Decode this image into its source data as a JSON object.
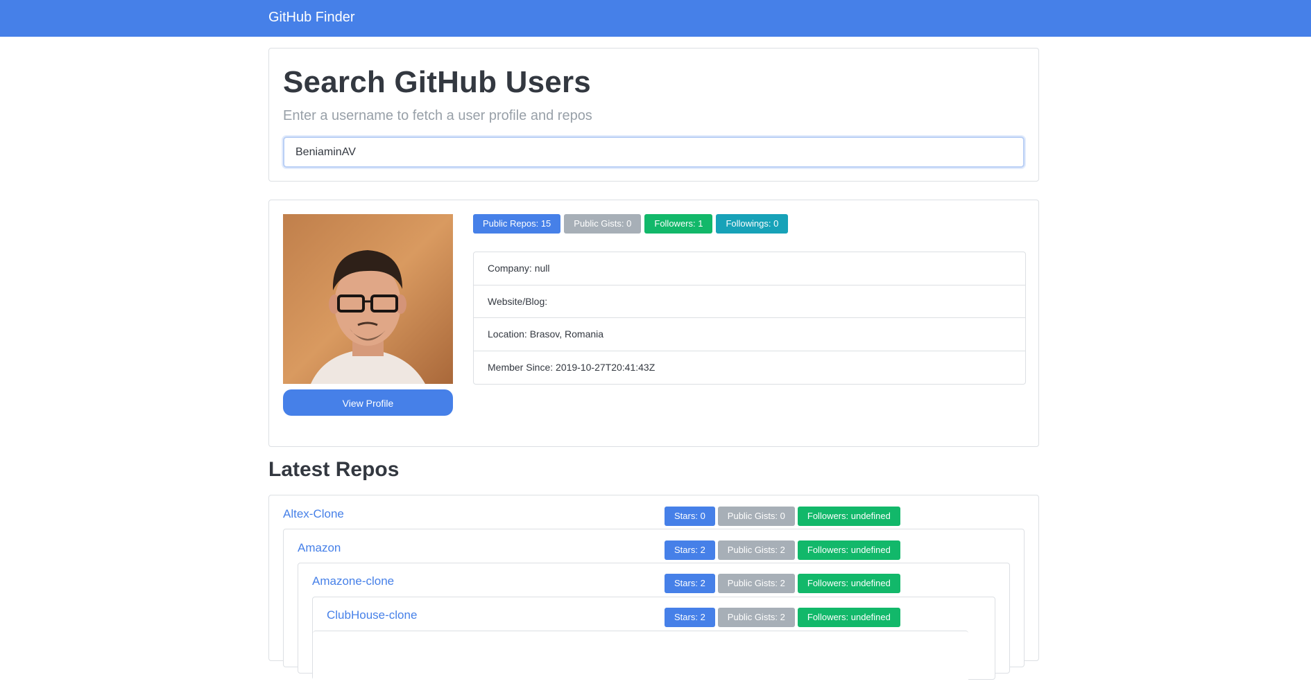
{
  "navbar": {
    "brand": "GitHub Finder"
  },
  "search": {
    "title": "Search GitHub Users",
    "subtitle": "Enter a username to fetch a user profile and repos",
    "value": "BeniaminAV",
    "placeholder": ""
  },
  "profile": {
    "view_profile_label": "View Profile",
    "badges": [
      {
        "label": "Public Repos: 15",
        "color": "#4680e8"
      },
      {
        "label": "Public Gists: 0",
        "color": "#a7afb7"
      },
      {
        "label": "Followers: 1",
        "color": "#12b86a"
      },
      {
        "label": "Followings: 0",
        "color": "#17a2b8"
      }
    ],
    "info": [
      "Company: null",
      "Website/Blog:",
      "Location: Brasov, Romania",
      "Member Since: 2019-10-27T20:41:43Z"
    ]
  },
  "repos": {
    "title": "Latest Repos",
    "items": [
      {
        "name": "Altex-Clone",
        "stars": "Stars: 0",
        "gists": "Public Gists: 0",
        "followers": "Followers: undefined"
      },
      {
        "name": "Amazon",
        "stars": "Stars: 2",
        "gists": "Public Gists: 2",
        "followers": "Followers: undefined"
      },
      {
        "name": "Amazone-clone",
        "stars": "Stars: 2",
        "gists": "Public Gists: 2",
        "followers": "Followers: undefined"
      },
      {
        "name": "ClubHouse-clone",
        "stars": "Stars: 2",
        "gists": "Public Gists: 2",
        "followers": "Followers: undefined"
      }
    ]
  },
  "colors": {
    "accent": "#4680e8",
    "gray_badge": "#a7afb7",
    "green_badge": "#12b86a",
    "teal_badge": "#17a2b8"
  }
}
